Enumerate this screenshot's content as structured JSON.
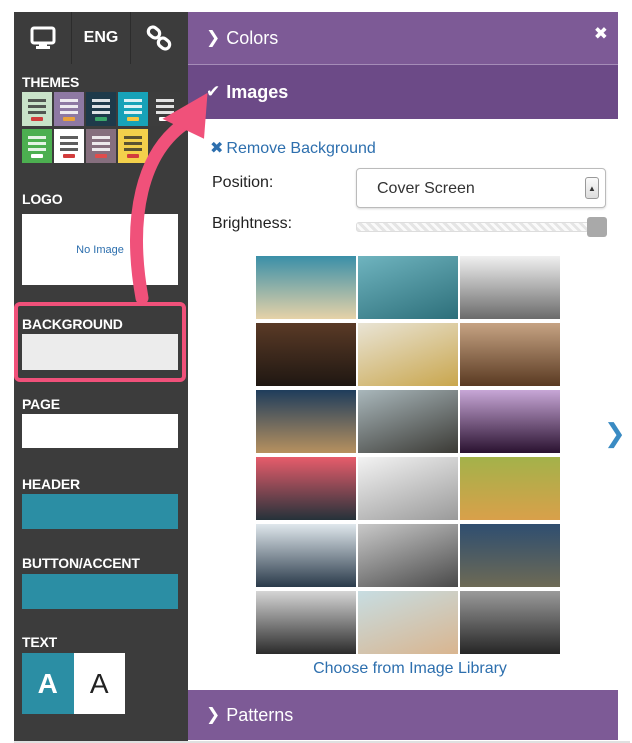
{
  "sidebar": {
    "toolbar": {
      "monitor_icon": "monitor-icon",
      "lang": "ENG",
      "link_icon": "link-icon"
    },
    "themes_label": "THEMES",
    "themes": [
      {
        "bg": "#c9e3c9",
        "accent": "#d23c3c",
        "dark": true
      },
      {
        "bg": "#8e79a3",
        "accent": "#e9a23b",
        "dark": false
      },
      {
        "bg": "#1e3a4a",
        "accent": "#3aa66a",
        "dark": false
      },
      {
        "bg": "#17a2b8",
        "accent": "#f5c542",
        "dark": false
      },
      {
        "bg": "#3d3d3d",
        "accent": "#ffffff",
        "dark": false
      },
      {
        "bg": "#4caf50",
        "accent": "#ffffff",
        "dark": false
      },
      {
        "bg": "#ffffff",
        "accent": "#d23c3c",
        "dark": true
      },
      {
        "bg": "#866f7e",
        "accent": "#e04c4c",
        "dark": false
      },
      {
        "bg": "#f3d04b",
        "accent": "#d23c3c",
        "dark": true
      }
    ],
    "logo_label": "LOGO",
    "logo_placeholder": "No Image",
    "background_label": "BACKGROUND",
    "page_label": "PAGE",
    "header_label": "HEADER",
    "button_label": "BUTTON/ACCENT",
    "text_label": "TEXT",
    "text_sample_1": "A",
    "text_sample_2": "A",
    "colors": {
      "background": "#ececec",
      "page": "#ffffff",
      "header": "#2b8ea4",
      "accent": "#2b8ea4"
    }
  },
  "panel": {
    "colors_title": "Colors",
    "images_title": "Images",
    "patterns_title": "Patterns",
    "remove_background": "Remove Background",
    "position_label": "Position:",
    "position_value": "Cover Screen",
    "brightness_label": "Brightness:",
    "brightness_value": 1.0,
    "choose_library": "Choose from Image Library",
    "header_color": "#7d5a96",
    "images": [
      {
        "name": "beach-image",
        "c1": "#3a8fa8",
        "c2": "#e6d2a8"
      },
      {
        "name": "gondola-image",
        "c1": "#6fb4bf",
        "c2": "#2d6f7a"
      },
      {
        "name": "fog-image",
        "c1": "#f0f0f0",
        "c2": "#6b6b6b"
      },
      {
        "name": "desk-camera-image",
        "c1": "#5a3a26",
        "c2": "#1f1712"
      },
      {
        "name": "field-tree-image",
        "c1": "#e9e4d5",
        "c2": "#c9a64d"
      },
      {
        "name": "bear-image",
        "c1": "#c6a383",
        "c2": "#5a3a22"
      },
      {
        "name": "ocean-pier-image",
        "c1": "#1f3d5c",
        "c2": "#b7915f"
      },
      {
        "name": "mountain-image",
        "c1": "#a9b7bb",
        "c2": "#3b3a35"
      },
      {
        "name": "purple-bokeh-image",
        "c1": "#c7a6d6",
        "c2": "#2a1230"
      },
      {
        "name": "bokeh-lights-image",
        "c1": "#e75c6b",
        "c2": "#25323a"
      },
      {
        "name": "snowy-plain-image",
        "c1": "#f3f3f3",
        "c2": "#9a9a9a"
      },
      {
        "name": "wheat-field-image",
        "c1": "#a3b24a",
        "c2": "#d9a04a"
      },
      {
        "name": "clock-image",
        "c1": "#dfe7ec",
        "c2": "#2a3a4a"
      },
      {
        "name": "road-image",
        "c1": "#c9c9c9",
        "c2": "#4a4a4a"
      },
      {
        "name": "winding-road-image",
        "c1": "#2f4e70",
        "c2": "#6d6a55"
      },
      {
        "name": "camera-image",
        "c1": "#d5d5d5",
        "c2": "#2b2b2b"
      },
      {
        "name": "map-hands-image",
        "c1": "#c7dde2",
        "c2": "#d9b58f"
      },
      {
        "name": "keyboard-image",
        "c1": "#9a9a9a",
        "c2": "#262626"
      }
    ]
  }
}
